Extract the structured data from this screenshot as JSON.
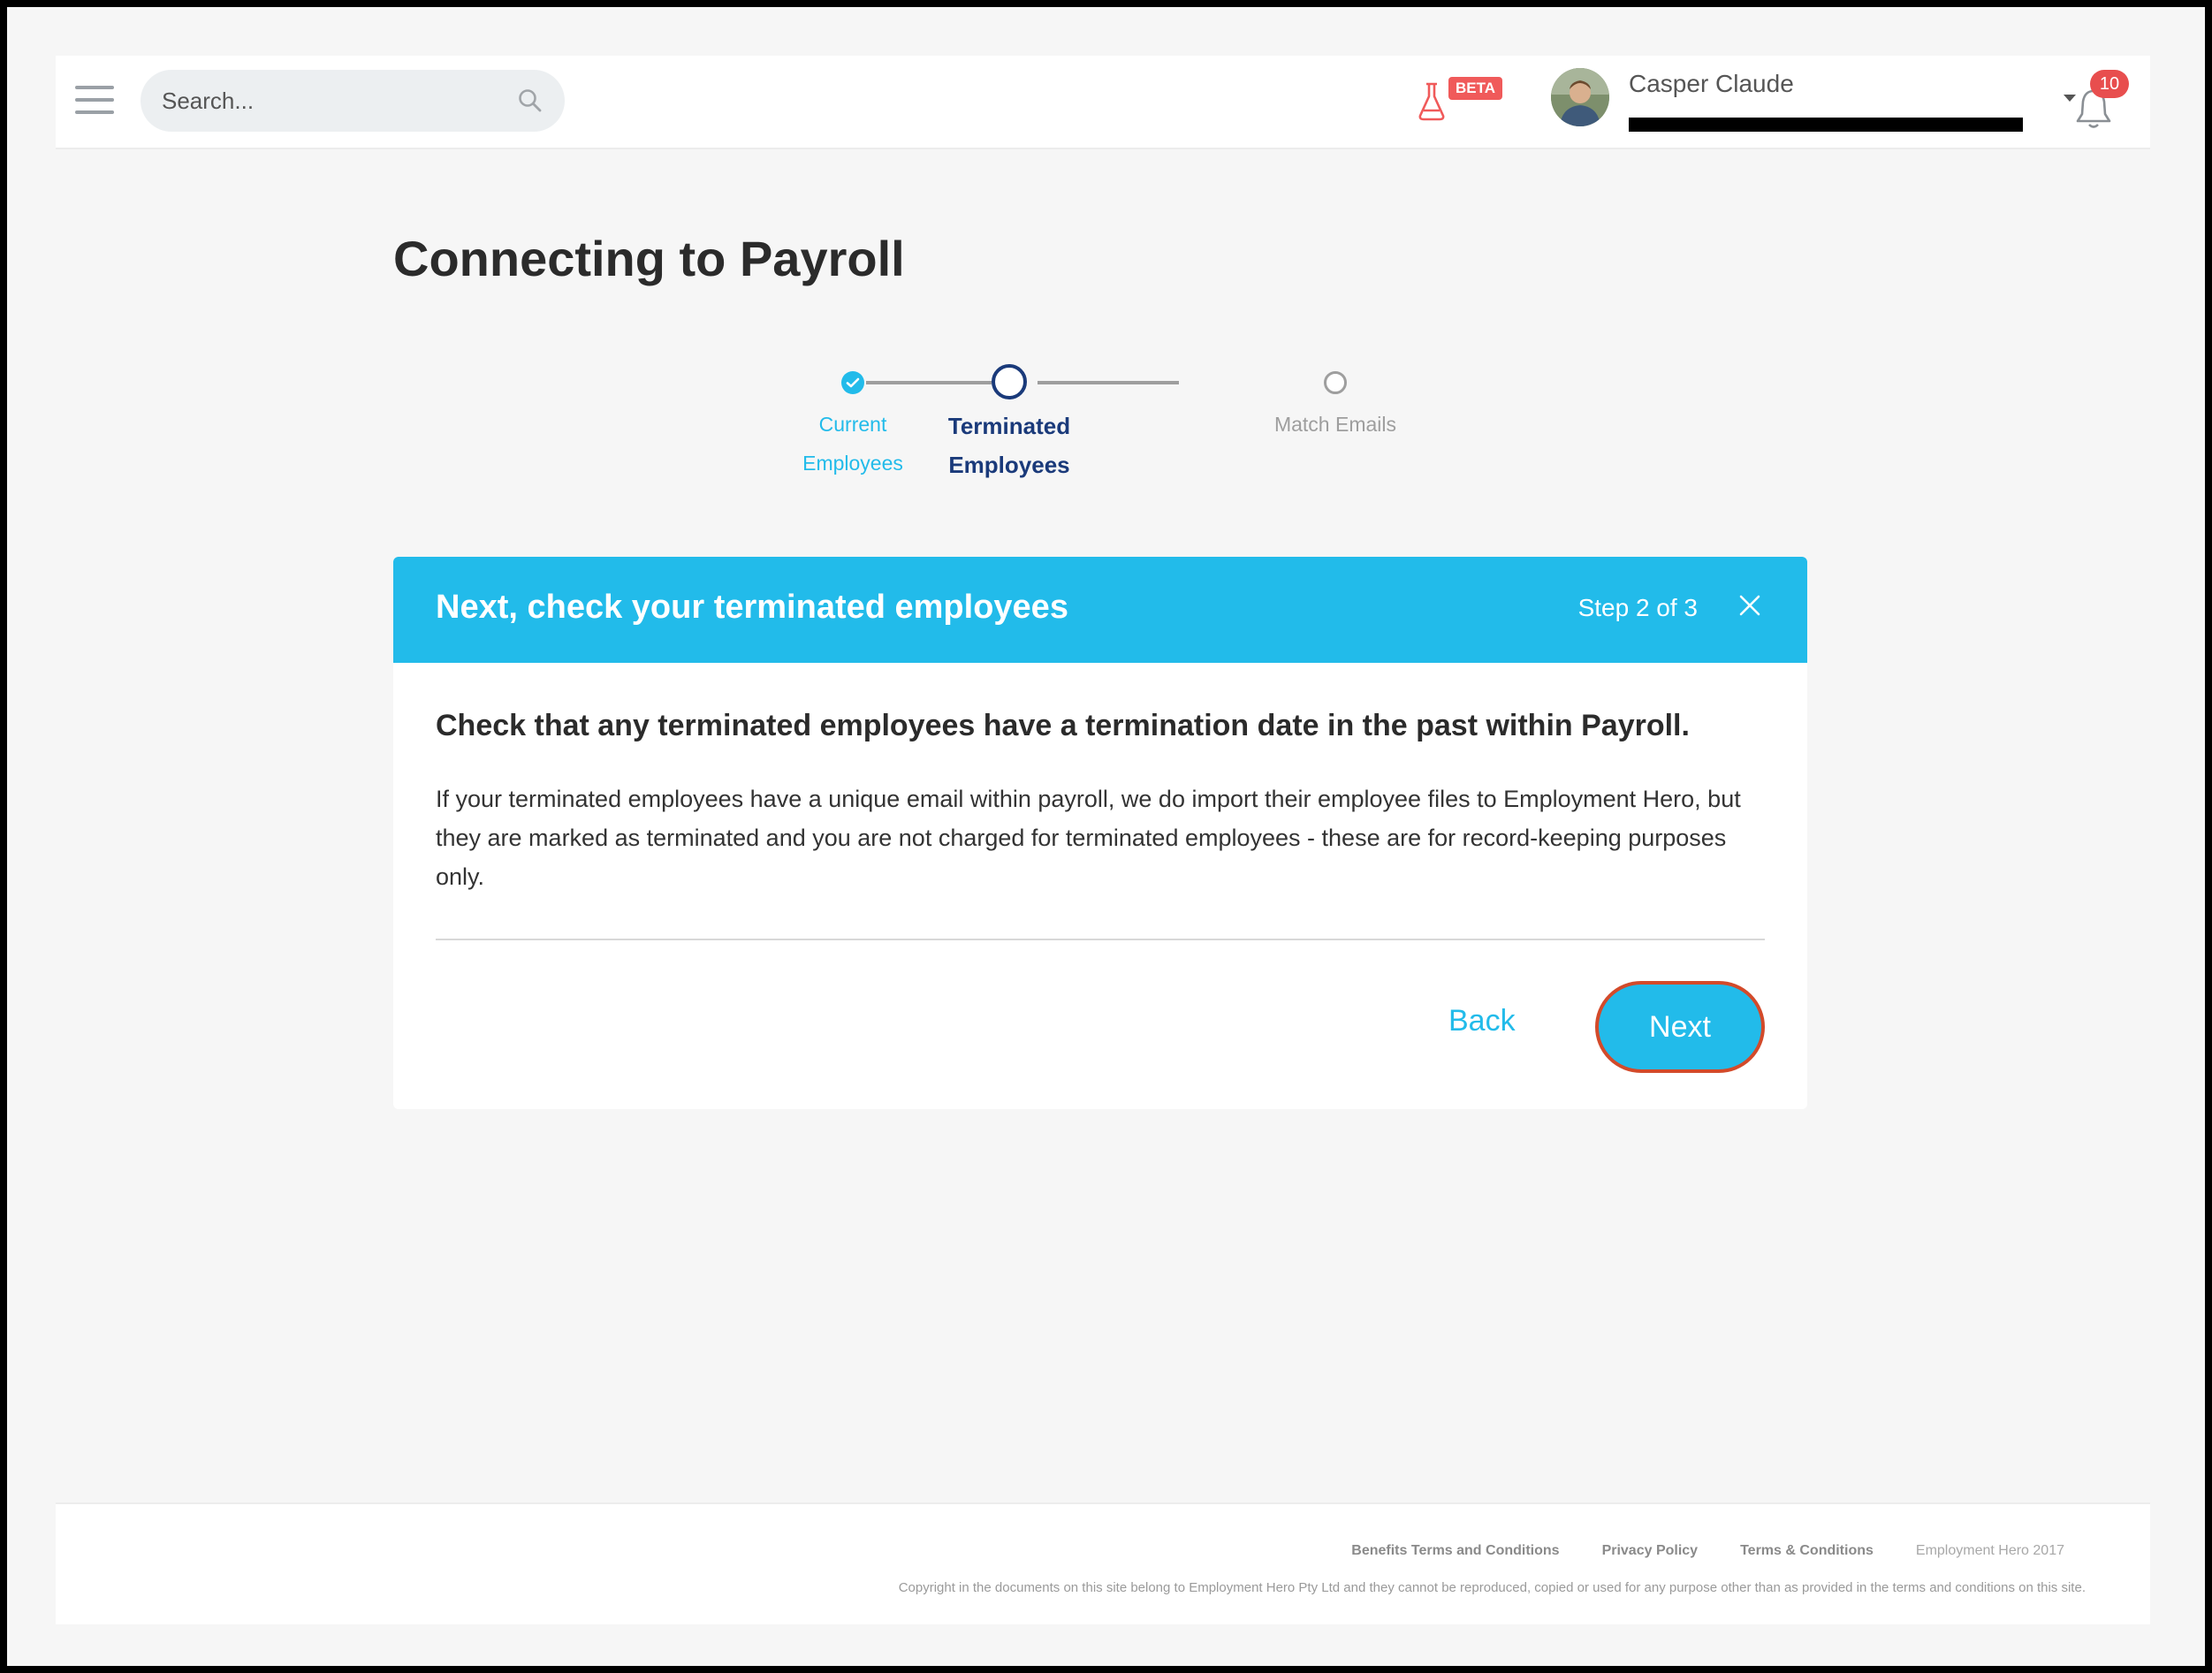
{
  "header": {
    "search_placeholder": "Search...",
    "beta_label": "BETA",
    "user_name": "Casper Claude",
    "notification_count": "10"
  },
  "page": {
    "title": "Connecting to Payroll"
  },
  "stepper": {
    "steps": [
      {
        "label": "Current Employees",
        "state": "complete"
      },
      {
        "label": "Terminated Employees",
        "state": "active"
      },
      {
        "label": "Match Emails",
        "state": "upcoming"
      }
    ]
  },
  "card": {
    "title": "Next, check your terminated employees",
    "step_text": "Step 2 of 3",
    "heading": "Check that any terminated employees have a termination date in the past within Payroll.",
    "body": "If your terminated employees have a unique email within payroll, we do import their employee files to Employment Hero, but they are marked as terminated and you are not charged for terminated employees - these are for record-keeping purposes only.",
    "back_label": "Back",
    "next_label": "Next"
  },
  "footer": {
    "links": [
      "Benefits Terms and Conditions",
      "Privacy Policy",
      "Terms & Conditions"
    ],
    "brand": "Employment Hero 2017",
    "copyright": "Copyright in the documents on this site belong to Employment Hero Pty Ltd and they cannot be reproduced, copied or used for any purpose other than as provided in the terms and conditions on this site."
  },
  "colors": {
    "accent": "#22bbea",
    "active_step": "#1a3a7a",
    "badge_red": "#e84e4e",
    "highlight_outline": "#d34a2a"
  },
  "icons": [
    "hamburger-icon",
    "search-icon",
    "flask-icon",
    "caret-down-icon",
    "bell-icon",
    "check-icon",
    "close-icon"
  ]
}
